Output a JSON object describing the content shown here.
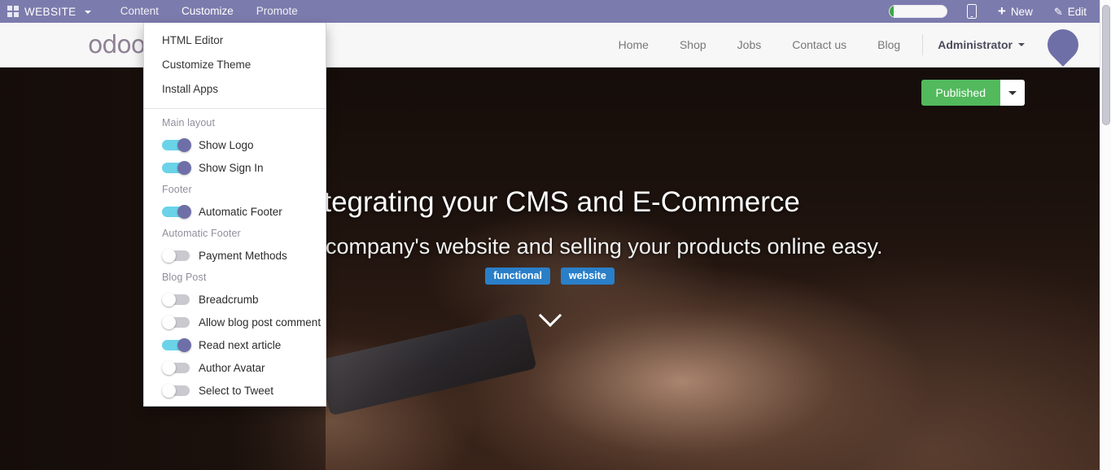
{
  "adminbar": {
    "apps_icon": "apps-grid-icon",
    "brand": "WEBSITE",
    "menu": [
      {
        "label": "Content"
      },
      {
        "label": "Customize"
      },
      {
        "label": "Promote"
      }
    ],
    "progress_percent": 8,
    "mobile_icon": "mobile-preview-icon",
    "new_icon": "plus-icon",
    "new_label": "New",
    "edit_icon": "pencil-icon",
    "edit_label": "Edit"
  },
  "dropdown": {
    "items": [
      {
        "label": "HTML Editor"
      },
      {
        "label": "Customize Theme"
      },
      {
        "label": "Install Apps"
      }
    ],
    "sections": [
      {
        "title": "Main layout",
        "toggles": [
          {
            "label": "Show Logo",
            "on": true
          },
          {
            "label": "Show Sign In",
            "on": true
          }
        ]
      },
      {
        "title": "Footer",
        "toggles": [
          {
            "label": "Automatic Footer",
            "on": true
          }
        ]
      },
      {
        "title": "Automatic Footer",
        "toggles": [
          {
            "label": "Payment Methods",
            "on": false
          }
        ]
      },
      {
        "title": "Blog Post",
        "toggles": [
          {
            "label": "Breadcrumb",
            "on": false
          },
          {
            "label": "Allow blog post comment",
            "on": false
          },
          {
            "label": "Read next article",
            "on": true
          },
          {
            "label": "Author Avatar",
            "on": false
          },
          {
            "label": "Select to Tweet",
            "on": false
          }
        ]
      }
    ]
  },
  "site_header": {
    "logo": "odoo",
    "nav": [
      {
        "label": "Home"
      },
      {
        "label": "Shop"
      },
      {
        "label": "Jobs"
      },
      {
        "label": "Contact us"
      },
      {
        "label": "Blog"
      }
    ],
    "user": "Administrator",
    "avatar": "user-avatar"
  },
  "hero": {
    "title": "Integrating your CMS and E-Commerce",
    "subtitle": "Make your company's website and selling your products online easy.",
    "tags": [
      {
        "label": "functional"
      },
      {
        "label": "website"
      }
    ],
    "scroll_icon": "chevron-down-icon"
  },
  "publish": {
    "label": "Published",
    "caret_icon": "caret-down-icon"
  },
  "colors": {
    "adminbar": "#7c7bad",
    "publish_green": "#52b95c",
    "tag_blue": "#2a7fc9",
    "toggle_on_track": "#6ad3e8",
    "toggle_on_knob": "#6f6fa8",
    "toggle_off_track": "#c9c9cf"
  }
}
